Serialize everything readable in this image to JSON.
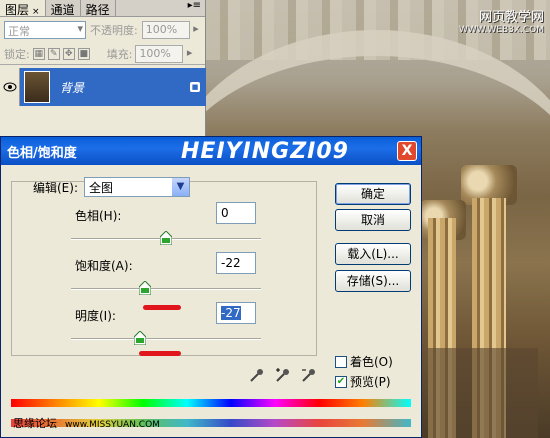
{
  "layers_panel": {
    "tabs": [
      {
        "label": "图层",
        "close": "×",
        "active": true
      },
      {
        "label": "通道",
        "active": false
      },
      {
        "label": "路径",
        "active": false
      }
    ],
    "blend_mode": "正常",
    "opacity_label": "不透明度:",
    "opacity_value": "100%",
    "lock_label": "锁定:",
    "fill_label": "填充:",
    "fill_value": "100%",
    "layer": {
      "name": "背景",
      "selected": true
    }
  },
  "watermark_top": {
    "title": "网页教学网",
    "url": "WWW.WEB3X.COM"
  },
  "dialog": {
    "title": "色相/饱和度",
    "brand": "HEIYINGZI09",
    "close_symbol": "X",
    "edit_label": "编辑(E):",
    "edit_value": "全图",
    "hue": {
      "label": "色相(H):",
      "value": "0",
      "level": 0.5
    },
    "saturation": {
      "label": "饱和度(A):",
      "value": "-22",
      "level": 0.39
    },
    "lightness": {
      "label": "明度(I):",
      "value": "-27",
      "level": 0.365
    },
    "buttons": {
      "ok": "确定",
      "cancel": "取消",
      "load": "载入(L)...",
      "save": "存储(S)..."
    },
    "colorize": {
      "label": "着色(O)",
      "checked": false
    },
    "preview": {
      "label": "预览(P)",
      "checked": true
    },
    "accent_red": "#e1161c",
    "title_blue": "#0a5fd8"
  },
  "footer_watermark": {
    "text": "思缘论坛",
    "url": "www.MISSYUAN.COM"
  }
}
